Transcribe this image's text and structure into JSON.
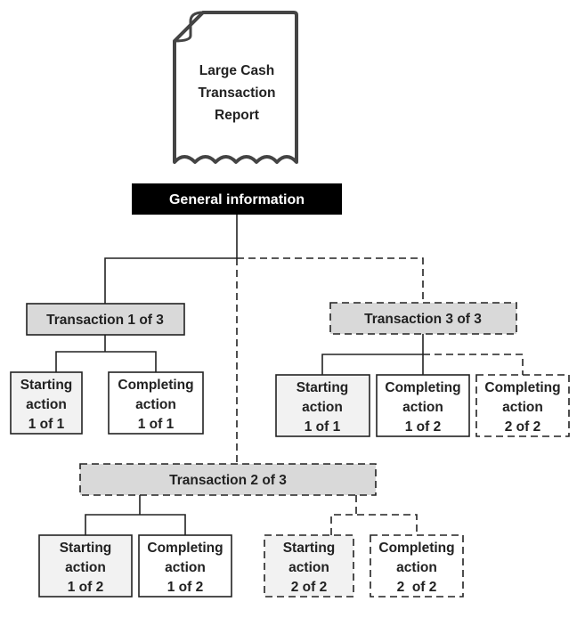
{
  "document_icon": {
    "title_lines": [
      "Large Cash",
      "Transaction",
      "Report"
    ]
  },
  "general": {
    "label": "General information"
  },
  "transactions": [
    {
      "label": "Transaction 1 of 3",
      "style": "solid",
      "actions": [
        {
          "lines": [
            "Starting",
            "action",
            "1 of 1"
          ],
          "style": "solid"
        },
        {
          "lines": [
            "Completing",
            "action",
            "1 of 1"
          ],
          "style": "solid"
        }
      ]
    },
    {
      "label": "Transaction 2 of 3",
      "style": "dashed",
      "actions": [
        {
          "lines": [
            "Starting",
            "action",
            "1 of 2"
          ],
          "style": "solid"
        },
        {
          "lines": [
            "Completing",
            "action",
            "1 of 2"
          ],
          "style": "solid"
        },
        {
          "lines": [
            "Starting",
            "action",
            "2 of 2"
          ],
          "style": "dashed"
        },
        {
          "lines": [
            "Completing",
            "action",
            "2  of 2"
          ],
          "style": "dashed"
        }
      ]
    },
    {
      "label": "Transaction 3 of 3",
      "style": "dashed",
      "actions": [
        {
          "lines": [
            "Starting",
            "action",
            "1 of 1"
          ],
          "style": "solid"
        },
        {
          "lines": [
            "Completing",
            "action",
            "1 of 2"
          ],
          "style": "solid"
        },
        {
          "lines": [
            "Completing",
            "action",
            "2  of 2"
          ],
          "style": "dashed"
        }
      ]
    }
  ],
  "colors": {
    "header_bg": "#000000",
    "transaction_fill": "#d9d9d9",
    "starting_fill": "#f2f2f2",
    "completing_fill": "#ffffff"
  }
}
